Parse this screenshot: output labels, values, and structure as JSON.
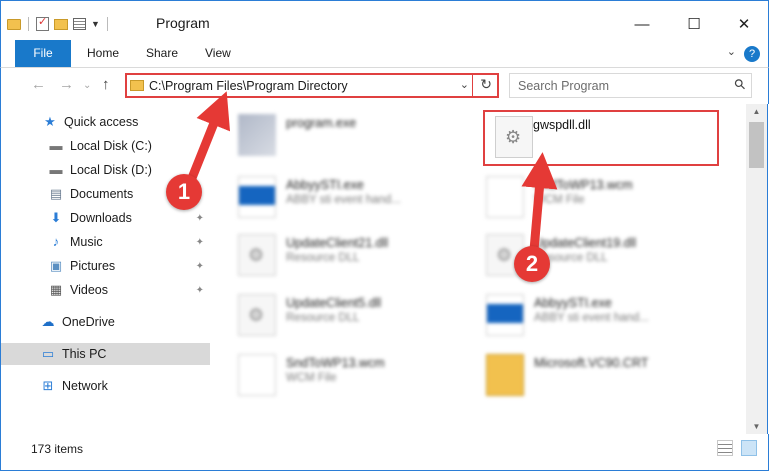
{
  "window": {
    "title": "Program",
    "minimize": "—",
    "maximize": "☐",
    "close": "✕"
  },
  "ribbon": {
    "tabs": [
      "File",
      "Home",
      "Share",
      "View"
    ],
    "help": "?"
  },
  "address_bar": {
    "path": "C:\\Program Files\\Program Directory",
    "dropdown": "⌄",
    "refresh": "↻"
  },
  "search": {
    "placeholder": "Search Program",
    "icon": "⚲"
  },
  "nav": {
    "back": "←",
    "forward": "→",
    "recent": "⌄",
    "up": "↑"
  },
  "sidebar": {
    "items": [
      {
        "label": "Quick access",
        "icon": "★"
      },
      {
        "label": "Local Disk (C:)",
        "icon": "▬"
      },
      {
        "label": "Local Disk (D:)",
        "icon": "▬"
      },
      {
        "label": "Documents",
        "icon": "▤"
      },
      {
        "label": "Downloads",
        "icon": "⬇"
      },
      {
        "label": "Music",
        "icon": "♪"
      },
      {
        "label": "Pictures",
        "icon": "▣"
      },
      {
        "label": "Videos",
        "icon": "▦"
      },
      {
        "label": "OneDrive",
        "icon": "☁"
      },
      {
        "label": "This PC",
        "icon": "▭"
      },
      {
        "label": "Network",
        "icon": "⊞"
      }
    ],
    "pin": "📌"
  },
  "files": [
    {
      "name": "program.exe",
      "type": ""
    },
    {
      "name": "gwspdll.dll",
      "type": ""
    },
    {
      "name": "AbbyySTI.exe",
      "type": "ABBY sti event hand..."
    },
    {
      "name": "SndToWP13.wcm",
      "type": "WCM File"
    },
    {
      "name": "UpdateClient21.dll",
      "type": "Resource DLL"
    },
    {
      "name": "UpdateClient19.dll",
      "type": "Resource DLL"
    },
    {
      "name": "UpdateClient5.dll",
      "type": "Resource DLL"
    },
    {
      "name": "AbbyySTI.exe",
      "type": "ABBY sti event hand..."
    },
    {
      "name": "SndToWP13.wcm",
      "type": "WCM File"
    },
    {
      "name": "Microsoft.VC90.CRT",
      "type": ""
    }
  ],
  "status": {
    "count": "173 items"
  },
  "annotations": {
    "step1": "1",
    "step2": "2",
    "color": "#e53935"
  }
}
